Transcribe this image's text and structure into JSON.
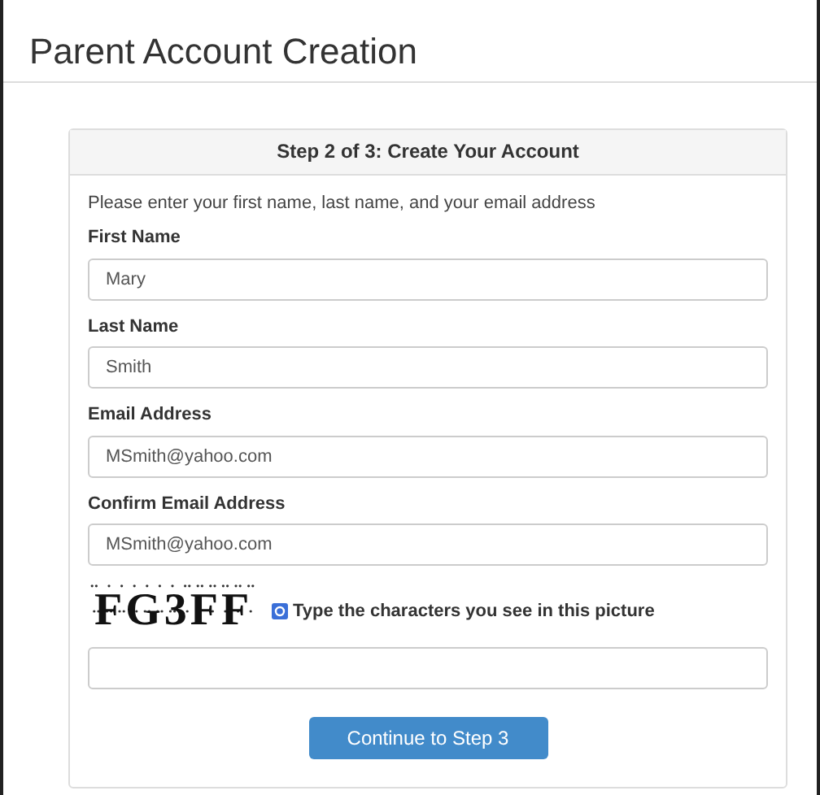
{
  "page_title": "Parent Account Creation",
  "panel": {
    "heading": "Step 2 of 3: Create Your Account",
    "intro": "Please enter your first name, last name, and your email address",
    "fields": [
      {
        "label": "First Name",
        "value": "Mary"
      },
      {
        "label": "Last Name",
        "value": "Smith"
      },
      {
        "label": "Email Address",
        "value": "MSmith@yahoo.com"
      },
      {
        "label": "Confirm Email Address",
        "value": "MSmith@yahoo.com"
      }
    ],
    "captcha": {
      "characters": "FG3FF",
      "prompt": "Type the characters you see in this picture"
    },
    "button": "Continue to Step 3"
  }
}
